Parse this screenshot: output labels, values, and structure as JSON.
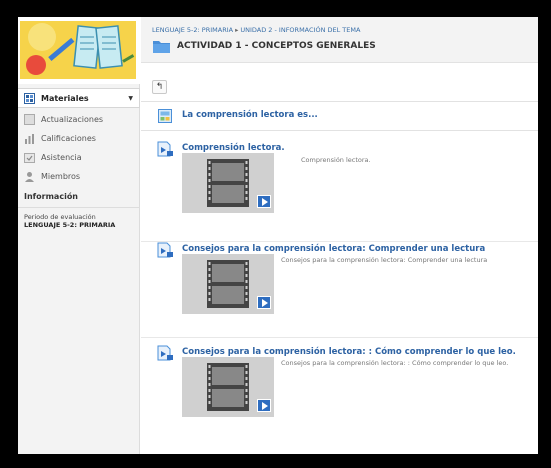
{
  "breadcrumb": {
    "course": "LENGUAJE 5-2: PRIMARIA",
    "separator": "▸",
    "unit": "UNIDAD 2 - INFORMACIÓN DEL TEMA"
  },
  "page_title": "ACTIVIDAD 1 - CONCEPTOS GENERALES",
  "sidebar": {
    "items": [
      {
        "label": "Materiales",
        "icon": "materials-icon",
        "active": true
      },
      {
        "label": "Actualizaciones",
        "icon": "updates-icon"
      },
      {
        "label": "Calificaciones",
        "icon": "grades-icon"
      },
      {
        "label": "Asistencia",
        "icon": "attendance-icon"
      },
      {
        "label": "Miembros",
        "icon": "members-icon"
      }
    ],
    "info_heading": "Información",
    "info_label": "Periodo de evaluación",
    "info_value": "LENGUAJE 5-2: PRIMARIA"
  },
  "toolbar": {
    "back_label": "↰"
  },
  "materials": [
    {
      "title": "La comprensión lectora es...",
      "type": "page"
    },
    {
      "title": "Comprensión lectora.",
      "description": "Comprensión lectora.",
      "type": "video"
    },
    {
      "title": "Consejos para la comprensión lectora: Comprender una lectura",
      "description": "Consejos para la comprensión lectora: Comprender una lectura",
      "type": "video"
    },
    {
      "title": "Consejos para la comprensión lectora: : Cómo comprender lo que leo.",
      "description": "Consejos para la comprensión lectora: : Cómo comprender lo que leo.",
      "type": "video"
    }
  ],
  "colors": {
    "link": "#2d62a3",
    "accent": "#2e6dc0",
    "sidebar_bg": "#f3f3f3"
  }
}
